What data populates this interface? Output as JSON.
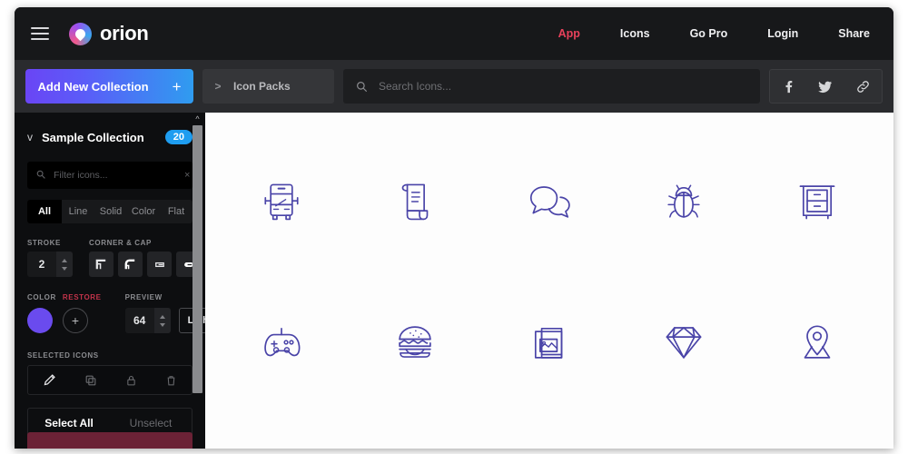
{
  "header": {
    "menu_icon": "hamburger-icon",
    "brand": "orion",
    "logo_icon": "orion-logo-icon",
    "nav": [
      {
        "label": "App",
        "active": true
      },
      {
        "label": "Icons",
        "active": false
      },
      {
        "label": "Go Pro",
        "active": false
      },
      {
        "label": "Login",
        "active": false
      },
      {
        "label": "Share",
        "active": false
      }
    ],
    "accent_active": "#e8415b",
    "bg": "#17181a"
  },
  "toolbar": {
    "add_collection_label": "Add New Collection",
    "add_collection_plus": "+",
    "gradient_from": "#6a45f5",
    "gradient_to": "#2f9cf0",
    "icon_packs_label": "Icon Packs",
    "icon_packs_chevron": ">",
    "search_placeholder": "Search Icons...",
    "search_value": "",
    "search_icon": "search-icon",
    "social": [
      {
        "name": "facebook-icon",
        "glyph": "f"
      },
      {
        "name": "twitter-icon",
        "glyph": "t"
      },
      {
        "name": "link-icon",
        "glyph": "link"
      }
    ]
  },
  "sidebar": {
    "collection_title": "Sample Collection",
    "collection_count": "20",
    "badge_color": "#1e9df0",
    "collapse_chevron": "v",
    "filter_placeholder": "Filter icons...",
    "filter_value": "",
    "filter_clear": "×",
    "tabs": [
      {
        "label": "All",
        "active": true
      },
      {
        "label": "Line",
        "active": false
      },
      {
        "label": "Solid",
        "active": false
      },
      {
        "label": "Color",
        "active": false
      },
      {
        "label": "Flat",
        "active": false
      }
    ],
    "stroke_label": "STROKE",
    "stroke_value": "2",
    "corner_cap_label": "CORNER & CAP",
    "corner_cap_options": [
      "sharp-corner-icon",
      "round-corner-icon",
      "butt-cap-icon",
      "round-cap-icon"
    ],
    "color_label": "COLOR",
    "restore_label": "RESTORE",
    "restore_color": "#c2334a",
    "color_value": "#6a4bee",
    "add_color_glyph": "+",
    "preview_label": "PREVIEW",
    "preview_size": "64",
    "preview_theme": "Light",
    "selected_icons_label": "SELECTED ICONS",
    "selected_actions": [
      {
        "name": "edit-pencil-icon",
        "enabled": true
      },
      {
        "name": "duplicate-icon",
        "enabled": false
      },
      {
        "name": "lock-icon",
        "enabled": false
      },
      {
        "name": "trash-icon",
        "enabled": false
      }
    ],
    "select_all_label": "Select All",
    "unselect_label": "Unselect",
    "scrollbar_up_arrow": "^"
  },
  "grid": {
    "background": "#fdfdfd",
    "icon_stroke": "#4a44a8",
    "icons": [
      {
        "name": "bus-icon"
      },
      {
        "name": "scroll-document-icon"
      },
      {
        "name": "chat-bubbles-icon"
      },
      {
        "name": "bug-icon"
      },
      {
        "name": "nightstand-drawer-icon"
      },
      {
        "name": "gamepad-icon"
      },
      {
        "name": "burger-icon"
      },
      {
        "name": "photo-gallery-icon"
      },
      {
        "name": "diamond-icon"
      },
      {
        "name": "map-pin-icon"
      }
    ]
  }
}
